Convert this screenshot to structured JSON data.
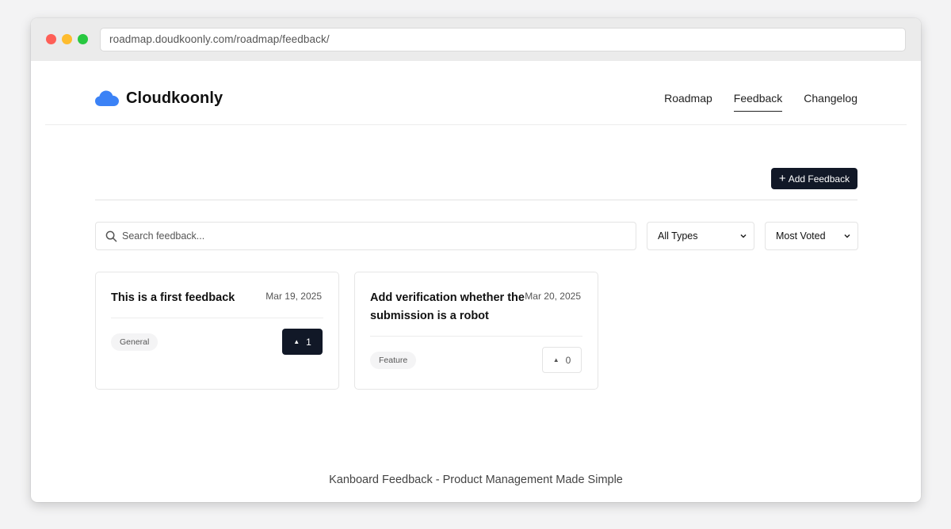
{
  "browser": {
    "url": "roadmap.doudkoonly.com/roadmap/feedback/"
  },
  "header": {
    "brand_name": "Cloudkoonly",
    "logo_icon": "cloud-icon",
    "brand_color": "#3b82f6",
    "nav": [
      {
        "label": "Roadmap",
        "active": false
      },
      {
        "label": "Feedback",
        "active": true
      },
      {
        "label": "Changelog",
        "active": false
      }
    ]
  },
  "toolbar": {
    "add_button_icon": "+",
    "add_button_label": "Add Feedback"
  },
  "filters": {
    "search_placeholder": "Search feedback...",
    "search_value": "",
    "type_select": "All Types",
    "sort_select": "Most Voted"
  },
  "feedback": [
    {
      "title": "This is a first feedback",
      "date": "Mar 19, 2025",
      "tag": "General",
      "votes": "1",
      "voted": true
    },
    {
      "title": "Add verification whether the submission is a robot",
      "date": "Mar 20, 2025",
      "tag": "Feature",
      "votes": "0",
      "voted": false
    }
  ],
  "footer": {
    "text": "Kanboard Feedback - Product Management Made Simple"
  },
  "colors": {
    "primary_dark": "#111827",
    "page_bg": "#f3f3f4"
  }
}
